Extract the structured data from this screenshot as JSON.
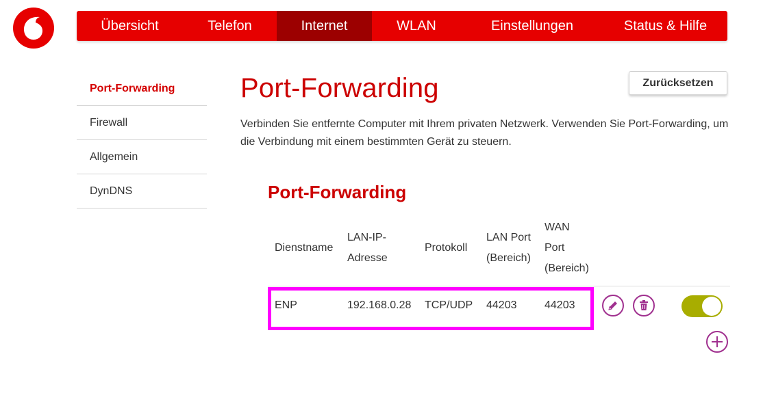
{
  "nav": {
    "items": [
      {
        "label": "Übersicht"
      },
      {
        "label": "Telefon"
      },
      {
        "label": "Internet",
        "active": true
      },
      {
        "label": "WLAN"
      },
      {
        "label": "Einstellungen"
      },
      {
        "label": "Status & Hilfe"
      }
    ]
  },
  "sidebar": {
    "items": [
      {
        "label": "Port-Forwarding",
        "active": true
      },
      {
        "label": "Firewall"
      },
      {
        "label": "Allgemein"
      },
      {
        "label": "DynDNS"
      }
    ]
  },
  "main": {
    "title": "Port-Forwarding",
    "reset_label": "Zurücksetzen",
    "description": "Verbinden Sie entfernte Computer mit Ihrem privaten Netzwerk. Verwenden Sie Port-Forwarding, um die Verbindung mit einem bestimmten Gerät zu steuern.",
    "section_title": "Port-Forwarding"
  },
  "table": {
    "headers": {
      "service": "Dienstname",
      "lan_ip_1": "LAN-IP-",
      "lan_ip_2": "Adresse",
      "protocol": "Protokoll",
      "lan_port_1": "LAN Port",
      "lan_port_2": "(Bereich)",
      "wan_port_1": "WAN",
      "wan_port_2": "Port",
      "wan_port_3": "(Bereich)"
    },
    "rows": [
      {
        "service": "ENP",
        "lan_ip": "192.168.0.28",
        "protocol": "TCP/UDP",
        "lan_port": "44203",
        "wan_port": "44203",
        "enabled": true
      }
    ]
  },
  "colors": {
    "brand_red": "#e60000",
    "active_tab": "#9c0000",
    "title_red": "#cc0000",
    "icon_purple": "#a0308f",
    "toggle_on": "#a8ad00",
    "highlight": "#ff00ff"
  },
  "icons": {
    "logo": "vodafone-speechmark-icon",
    "edit": "pencil-icon",
    "delete": "trash-icon",
    "add": "plus-icon"
  }
}
